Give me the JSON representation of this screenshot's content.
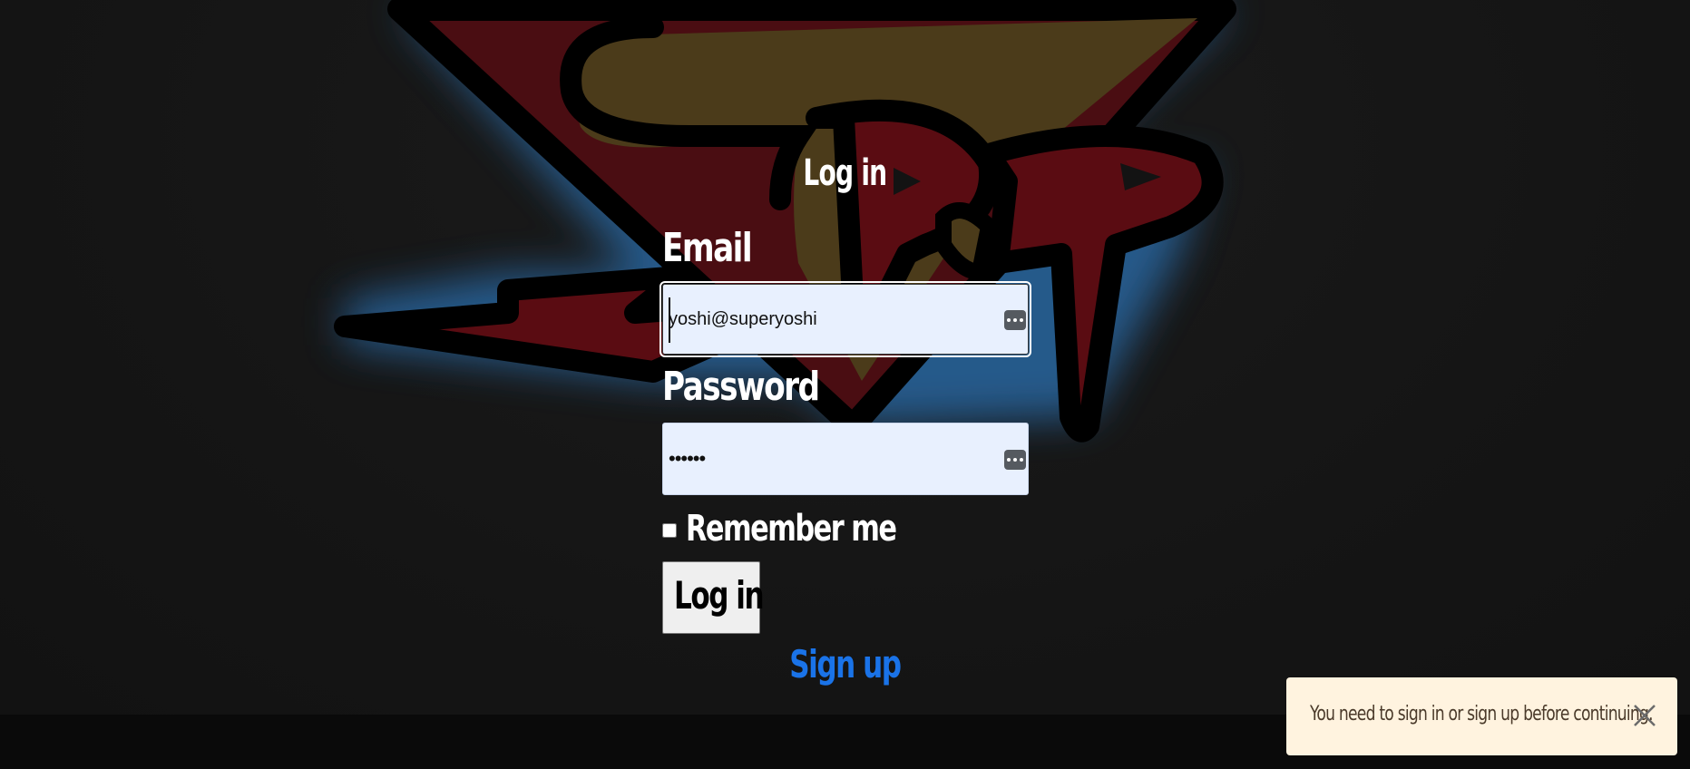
{
  "form": {
    "title": "Log in",
    "email_label": "Email",
    "email_value": "yoshi@superyoshi",
    "password_label": "Password",
    "password_value": "••••••",
    "remember_label": "Remember me",
    "remember_checked": false,
    "submit_label": "Log in",
    "signup_link": "Sign up"
  },
  "flash": {
    "message": "You need to sign in or sign up before continuing."
  },
  "colors": {
    "page_bg": "#131313",
    "input_bg": "#e8f0fe",
    "link": "#1a73e8",
    "toast_bg": "#fff3df",
    "logo_red": "#4a0d12",
    "logo_gold": "#4b3b1a"
  },
  "icons": {
    "password_manager": "password-manager-icon",
    "close": "close-icon"
  }
}
